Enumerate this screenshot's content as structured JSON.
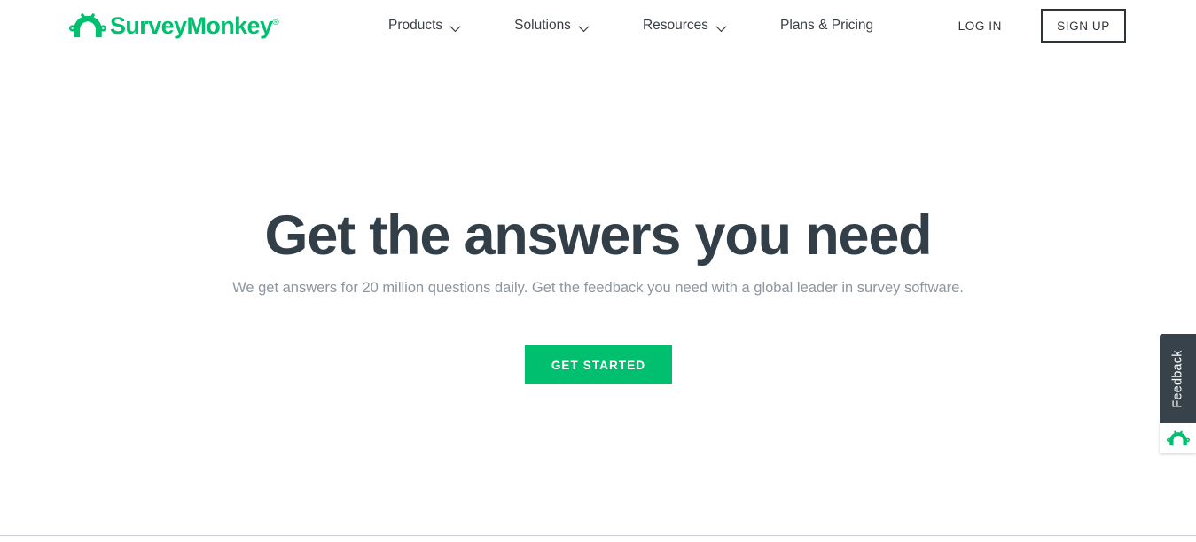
{
  "header": {
    "brand": {
      "name": "SurveyMonkey",
      "trademark": "®",
      "logo_icon": "monkey-logo-icon",
      "color": "#00bf6f"
    },
    "nav": [
      {
        "label": "Products",
        "icon": "chevron-down-icon",
        "has_dropdown": true
      },
      {
        "label": "Solutions",
        "icon": "chevron-down-icon",
        "has_dropdown": true
      },
      {
        "label": "Resources",
        "icon": "chevron-down-icon",
        "has_dropdown": true
      },
      {
        "label": "Plans & Pricing",
        "icon": "",
        "has_dropdown": false
      }
    ],
    "actions": {
      "login_label": "LOG IN",
      "signup_label": "SIGN UP"
    }
  },
  "hero": {
    "title": "Get the answers you need",
    "subtitle": "We get answers for 20 million questions daily. Get the feedback you need with a global leader in survey software.",
    "cta_label": "GET STARTED",
    "cta_color": "#00bf6f",
    "title_color": "#333f48",
    "subtitle_color": "#8d969e"
  },
  "feedback_widget": {
    "label": "Feedback",
    "tab_color": "#37424a",
    "logo_icon": "monkey-logo-icon"
  }
}
